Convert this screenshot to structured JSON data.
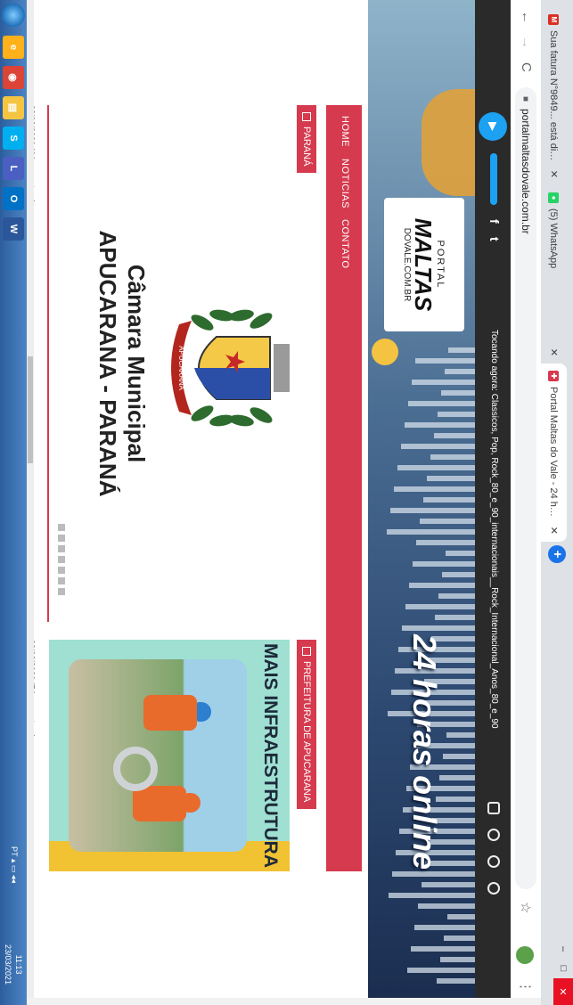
{
  "browser": {
    "tabs": [
      {
        "label": "Sua fatura N°9849... está dispon",
        "favicon": "gmail-icon",
        "color": "#d93025",
        "active": false
      },
      {
        "label": "(5) WhatsApp",
        "favicon": "whatsapp-icon",
        "color": "#25d366",
        "active": false
      },
      {
        "label": "Portal Maltas do Vale - 24 horas",
        "favicon": "portal-icon",
        "color": "#d63a4e",
        "active": true
      }
    ],
    "new_tab": "+",
    "url": "portalmaltasdovale.com.br",
    "nav": {
      "back": "←",
      "forward": "→",
      "reload": "C"
    },
    "window_controls": {
      "minimize": "–",
      "maximize": "□",
      "close": "✕"
    }
  },
  "player": {
    "volume": 1.0,
    "now_playing": "Tocando agora: Classicos, Pop, Rock_80_e_90_internacionais__Rock_Internacional_Anos_80_e_90",
    "social": [
      "f",
      "t"
    ]
  },
  "hero": {
    "logo_top": "PORTAL",
    "logo_main": "MALTAS",
    "logo_sub": "DOVALE.COM.BR",
    "slogan": "24 horas online"
  },
  "nav": {
    "items": [
      "HOME",
      "NOTICIAS",
      "CONTATO"
    ]
  },
  "main_story": {
    "category": "PARANÁ",
    "title_line1": "Câmara Municipal",
    "title_line2": "APUCARANA - PARANÁ",
    "crest_banner": "APUCARANA",
    "date": "23/03/2021 (4 horas atras)"
  },
  "side_story": {
    "category": "PREFEITURA DE APUCARANA",
    "headline": "MAIS INFRAESTRUTURA",
    "date": "23/03/2021 (5 horas atras)"
  },
  "taskbar": {
    "apps": [
      {
        "name": "ie-icon",
        "color": "#ffb11b",
        "glyph": "e"
      },
      {
        "name": "chrome-icon",
        "color": "#db4437",
        "glyph": "◉"
      },
      {
        "name": "explorer-icon",
        "color": "#f5c542",
        "glyph": "▤"
      },
      {
        "name": "skype-icon",
        "color": "#00aff0",
        "glyph": "S"
      },
      {
        "name": "teams-icon",
        "color": "#4a5fc1",
        "glyph": "L"
      },
      {
        "name": "outlook-icon",
        "color": "#0072c6",
        "glyph": "O"
      },
      {
        "name": "word-icon",
        "color": "#2b579a",
        "glyph": "W"
      }
    ],
    "language": "PT",
    "time": "11:13",
    "date": "23/03/2021"
  },
  "colors": {
    "accent": "#d63a4e",
    "player": "#2a2a2a",
    "taskbar": "#2c5e9e"
  }
}
